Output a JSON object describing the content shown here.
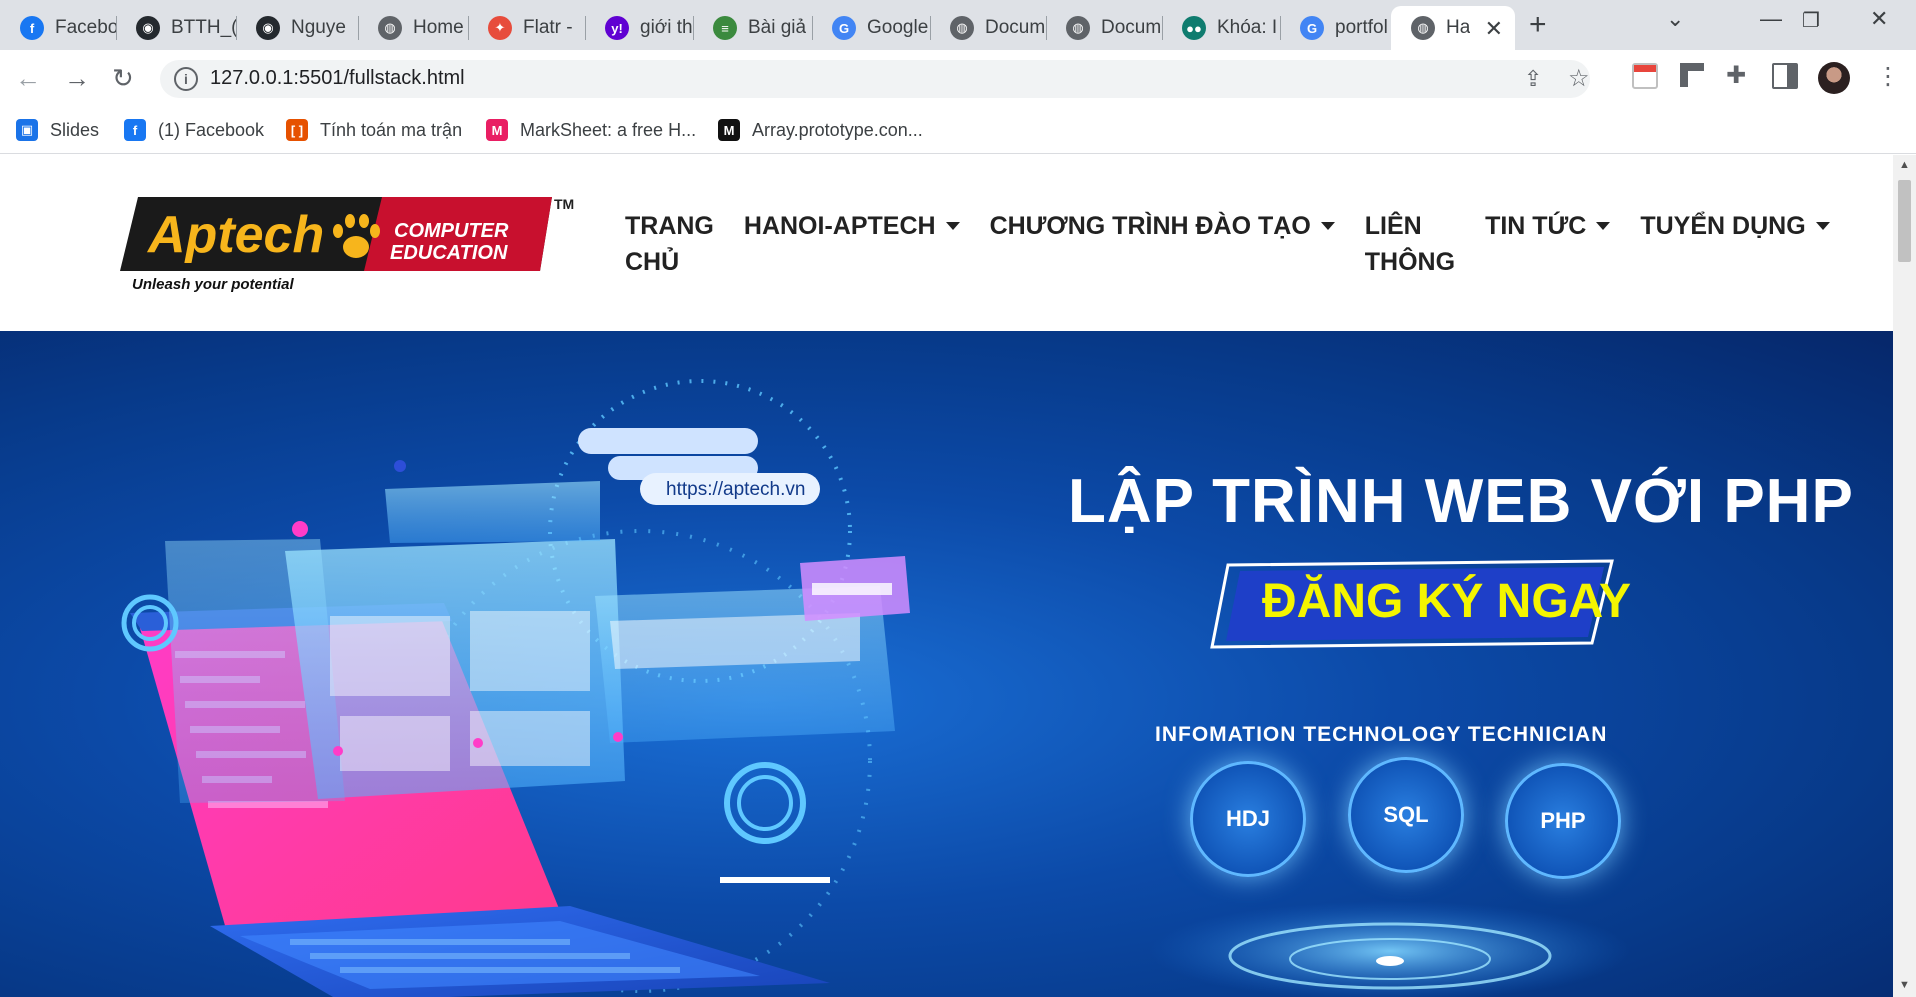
{
  "browser": {
    "tabs": [
      {
        "label": "Facebo",
        "icon": "facebook-icon",
        "color": "#1877f2",
        "glyph": "f"
      },
      {
        "label": "BTTH_(",
        "icon": "github-icon",
        "color": "#24292e",
        "glyph": "◉"
      },
      {
        "label": "Nguye",
        "icon": "github-icon",
        "color": "#24292e",
        "glyph": "◉"
      },
      {
        "label": "Home",
        "icon": "globe-icon",
        "color": "#5f6368",
        "glyph": "◍"
      },
      {
        "label": "Flatr - ",
        "icon": "flatr-icon",
        "color": "#e74c3c",
        "glyph": "✦"
      },
      {
        "label": "giới thi",
        "icon": "yahoo-icon",
        "color": "#6001d2",
        "glyph": "y!"
      },
      {
        "label": "Bài giả",
        "icon": "books-icon",
        "color": "#3b8a3e",
        "glyph": "≡"
      },
      {
        "label": "Google",
        "icon": "google-translate-icon",
        "color": "#4285f4",
        "glyph": "G"
      },
      {
        "label": "Docum",
        "icon": "globe-icon",
        "color": "#5f6368",
        "glyph": "◍"
      },
      {
        "label": "Docum",
        "icon": "globe-icon",
        "color": "#5f6368",
        "glyph": "◍"
      },
      {
        "label": "Khóa: I",
        "icon": "coursera-dots-icon",
        "color": "#0f7c6f",
        "glyph": "●●"
      },
      {
        "label": "portfol",
        "icon": "google-icon",
        "color": "#4285f4",
        "glyph": "G"
      },
      {
        "label": "Ha",
        "icon": "globe-icon",
        "color": "#5f6368",
        "glyph": "◍",
        "active": true
      }
    ],
    "url": "127.0.0.1:5501/fullstack.html",
    "bookmarks": [
      {
        "label": "Slides",
        "icon": "slides-icon",
        "color": "#1a73e8",
        "glyph": "▣"
      },
      {
        "label": "(1) Facebook",
        "icon": "facebook-icon",
        "color": "#1877f2",
        "glyph": "f"
      },
      {
        "label": "Tính toán ma trận",
        "icon": "matrix-icon",
        "color": "#e65100",
        "glyph": "[ ]"
      },
      {
        "label": "MarkSheet: a free H...",
        "icon": "marksheet-icon",
        "color": "#e91e63",
        "glyph": "M"
      },
      {
        "label": "Array.prototype.con...",
        "icon": "mdn-icon",
        "color": "#111111",
        "glyph": "M"
      }
    ]
  },
  "site": {
    "logo": {
      "brand": "Aptech",
      "line1": "COMPUTER",
      "line2": "EDUCATION",
      "tagline": "Unleash your potential",
      "tm": "TM"
    },
    "nav": [
      {
        "label": "TRANG CHỦ",
        "line1": "TRANG",
        "line2": "CHỦ",
        "dropdown": false
      },
      {
        "label": "HANOI-APTECH",
        "dropdown": true
      },
      {
        "label": "CHƯƠNG TRÌNH ĐÀO TẠO",
        "dropdown": true
      },
      {
        "label": "LIÊN THÔNG",
        "line1": "LIÊN",
        "line2": "THÔNG",
        "dropdown": false
      },
      {
        "label": "TIN TỨC",
        "dropdown": true
      },
      {
        "label": "TUYỂN DỤNG",
        "dropdown": true
      }
    ],
    "hero": {
      "title": "LẬP TRÌNH WEB VỚI PHP",
      "cta": "ĐĂNG KÝ NGAY",
      "subtitle": "INFOMATION TECHNOLOGY TECHNICIAN",
      "url_pill": "https://aptech.vn",
      "techs": [
        "HDJ",
        "SQL",
        "PHP"
      ],
      "colors": {
        "accent": "#f4f500",
        "cta_bg": "#1e3fc8",
        "primary": "#0c4aa8"
      }
    }
  }
}
